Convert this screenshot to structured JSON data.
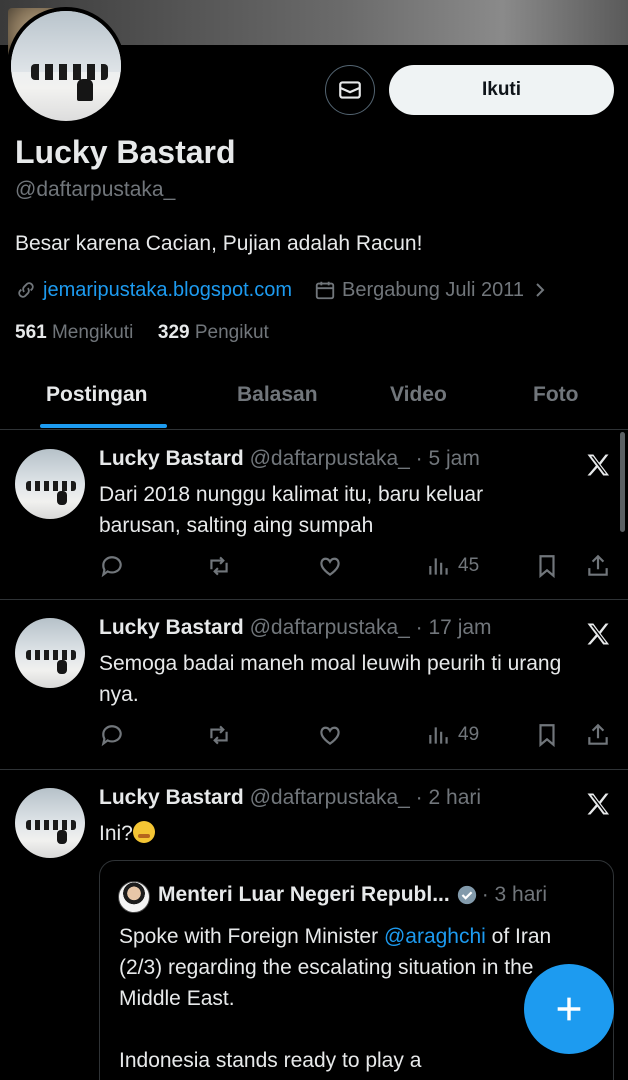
{
  "profile": {
    "name": "Lucky Bastard",
    "handle": "@daftarpustaka_",
    "bio": "Besar karena Cacian, Pujian adalah Racun!",
    "link": "jemaripustaka.blogspot.com",
    "joined": "Bergabung Juli 2011",
    "following_count": "561",
    "following_label": "Mengikuti",
    "followers_count": "329",
    "followers_label": "Pengikut"
  },
  "header": {
    "follow_label": "Ikuti",
    "message_icon": "envelope-icon"
  },
  "tabs": [
    {
      "label": "Postingan",
      "active": true
    },
    {
      "label": "Balasan",
      "active": false
    },
    {
      "label": "Video",
      "active": false
    },
    {
      "label": "Foto",
      "active": false
    }
  ],
  "posts": [
    {
      "name": "Lucky Bastard",
      "handle": "@daftarpustaka_",
      "time": "· 5 jam",
      "text": "Dari 2018 nunggu kalimat itu, baru keluar barusan, salting aing sumpah",
      "views": "45"
    },
    {
      "name": "Lucky Bastard",
      "handle": "@daftarpustaka_",
      "time": "· 17 jam",
      "text": "Semoga badai maneh moal leuwih peurih ti urang nya.",
      "views": "49"
    },
    {
      "name": "Lucky Bastard",
      "handle": "@daftarpustaka_",
      "time": "· 2 hari",
      "text": "Ini?",
      "quote": {
        "name": "Menteri Luar Negeri Republ...",
        "time": "· 3 hari",
        "text_before": "Spoke with Foreign Minister ",
        "mention": "@araghchi",
        "text_after": " of Iran (2/3) regarding the escalating situation in the Middle East.",
        "text2": "Indonesia stands ready to play a"
      }
    }
  ],
  "colors": {
    "accent": "#1d9bf0",
    "background": "#000000",
    "muted": "#71767b",
    "text": "#e7e9ea"
  }
}
